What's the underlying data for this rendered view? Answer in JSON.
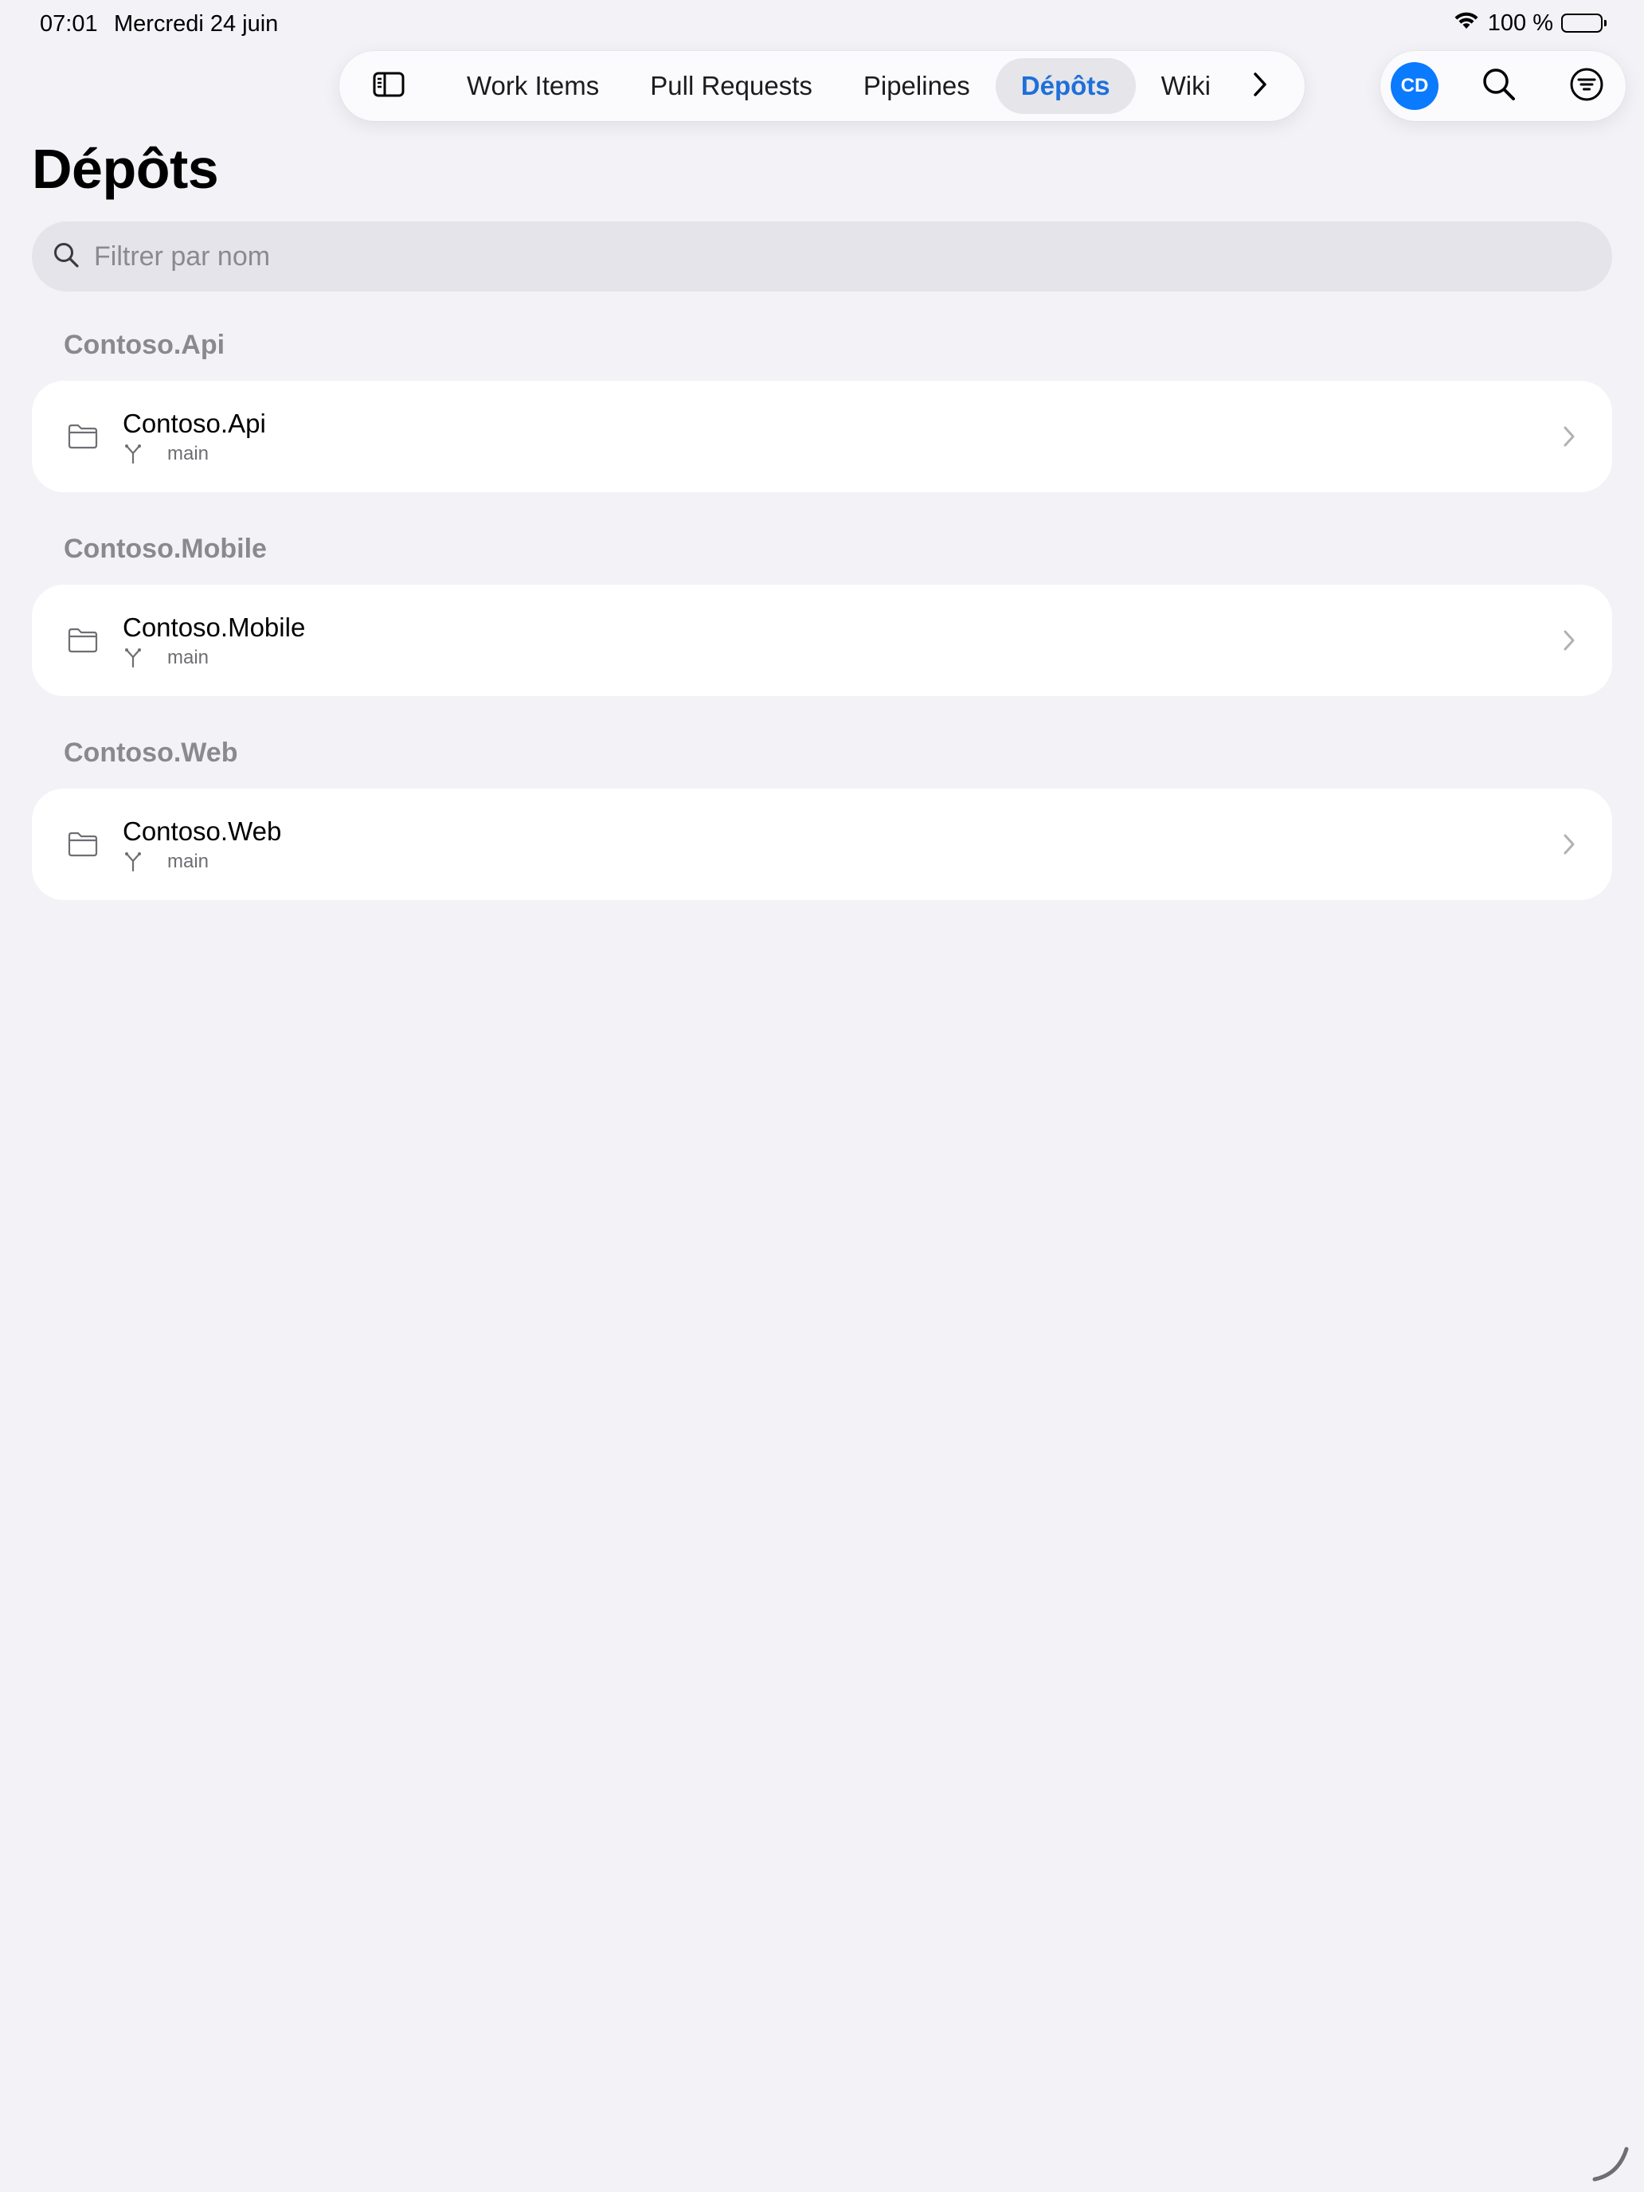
{
  "status_bar": {
    "time": "07:01",
    "date": "Mercredi 24 juin",
    "battery_text": "100 %"
  },
  "toolbar": {
    "sidebar_icon": "sidebar-icon",
    "tabs": [
      {
        "label": "Work Items",
        "active": false
      },
      {
        "label": "Pull Requests",
        "active": false
      },
      {
        "label": "Pipelines",
        "active": false
      },
      {
        "label": "Dépôts",
        "active": true
      },
      {
        "label": "Wiki",
        "active": false
      }
    ],
    "more_icon": "chevron-right-icon",
    "avatar_initials": "CD",
    "avatar_color": "#0a7aff",
    "accent_color": "#1e6fd9"
  },
  "page": {
    "title": "Dépôts"
  },
  "search": {
    "placeholder": "Filtrer par nom",
    "value": ""
  },
  "sections": [
    {
      "header": "Contoso.Api",
      "repo": {
        "name": "Contoso.Api",
        "branch": "main"
      }
    },
    {
      "header": "Contoso.Mobile",
      "repo": {
        "name": "Contoso.Mobile",
        "branch": "main"
      }
    },
    {
      "header": "Contoso.Web",
      "repo": {
        "name": "Contoso.Web",
        "branch": "main"
      }
    }
  ]
}
